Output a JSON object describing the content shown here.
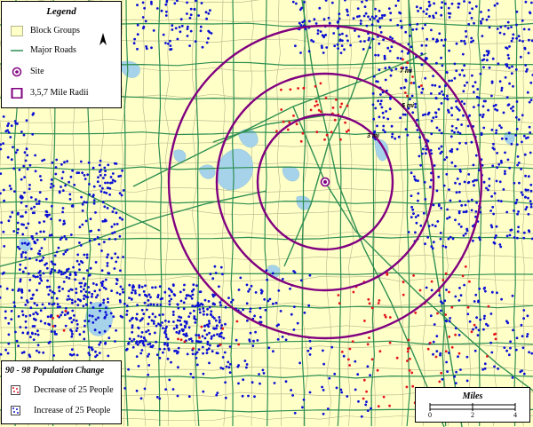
{
  "colors": {
    "block_groups": "#ffffc8",
    "block_outline": "#b5b58a",
    "water": "#a6d3ea",
    "roads": "#2f8f52",
    "radii": "#800080",
    "site": "#800080",
    "increase_dot": "#0a10d4",
    "decrease_dot": "#e4141c"
  },
  "legend": {
    "title": "Legend",
    "items": [
      {
        "symbol": "block-groups-swatch",
        "label": "Block Groups"
      },
      {
        "symbol": "major-roads-line",
        "label": "Major Roads"
      },
      {
        "symbol": "site-marker",
        "label": "Site"
      },
      {
        "symbol": "radii-square",
        "label": "3,5,7 Mile Radii"
      }
    ],
    "north_arrow": "N"
  },
  "ring_labels": {
    "r3": "3 mi",
    "r5": "5 mi",
    "r7": "7 mi"
  },
  "population_change": {
    "title": "90 - 98 Population Change",
    "items": [
      {
        "symbol": "red-dots",
        "label": "Decrease of 25 People"
      },
      {
        "symbol": "blue-dots",
        "label": "Increase of 25 People"
      }
    ]
  },
  "scale_bar": {
    "title": "Miles",
    "ticks": [
      "0",
      "2",
      "4"
    ]
  }
}
